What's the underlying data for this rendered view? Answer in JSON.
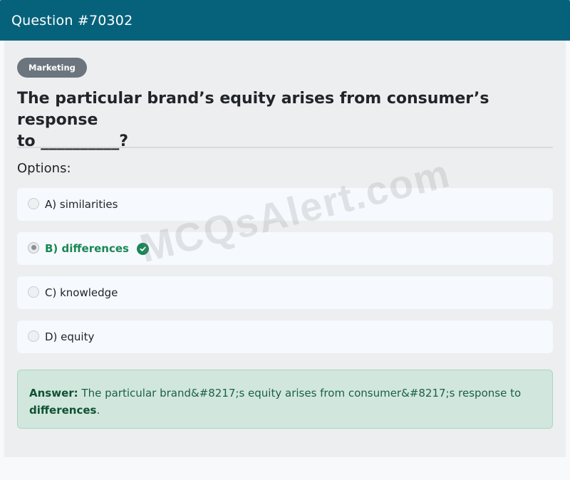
{
  "header": {
    "title": "Question #70302"
  },
  "category_badge": "Marketing",
  "question": {
    "line1": "The particular brand’s equity arises from consumer’s response",
    "line2": "to __________?"
  },
  "options_label": "Options:",
  "options": [
    {
      "label": "A) similarities",
      "selected": false,
      "correct": false
    },
    {
      "label": "B) differences",
      "selected": true,
      "correct": true
    },
    {
      "label": "C) knowledge",
      "selected": false,
      "correct": false
    },
    {
      "label": "D) equity",
      "selected": false,
      "correct": false
    }
  ],
  "answer": {
    "prefix": "Answer:",
    "text": " The particular brand&#8217;s equity arises from consumer&#8217;s response to ",
    "value": "differences",
    "suffix": "."
  },
  "watermark": "MCQsAlert.com",
  "colors": {
    "header": "#06627b",
    "correct": "#198754",
    "answer_bg": "#d1e7dd"
  }
}
